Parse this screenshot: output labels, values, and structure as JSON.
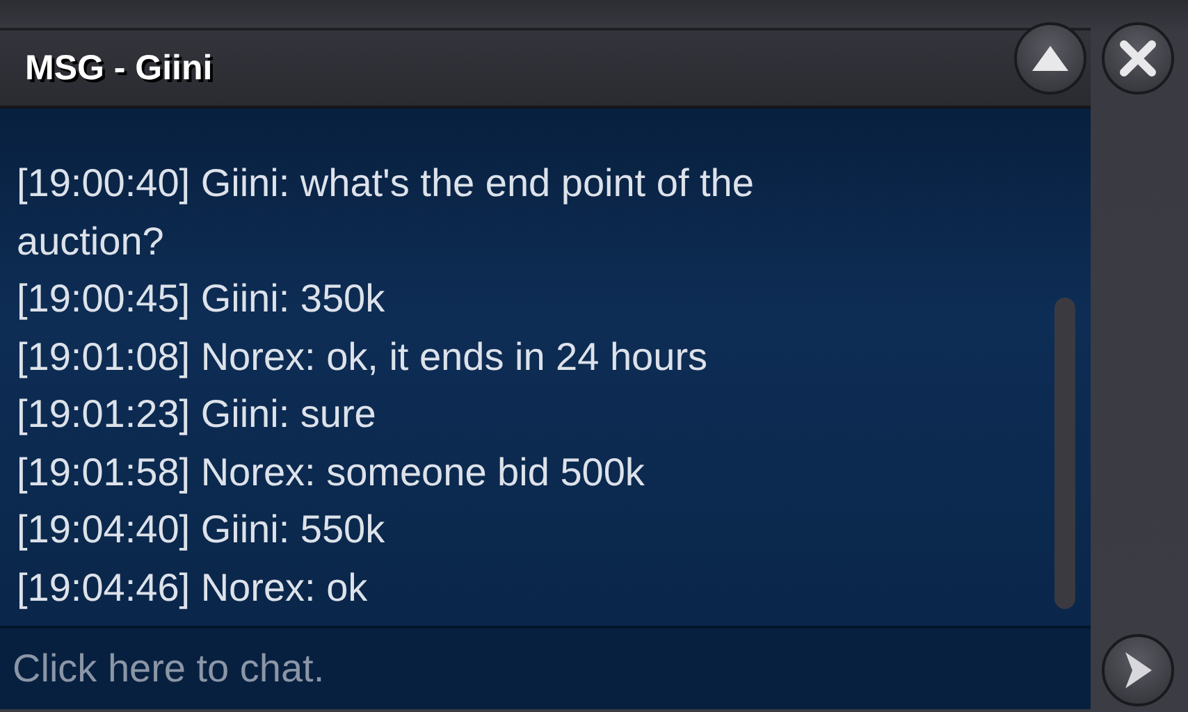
{
  "window": {
    "title": "MSG - Giini"
  },
  "messages": [
    {
      "time": "[19:00:40]",
      "sender": "Giini:",
      "text": "what's the end point of the auction?"
    },
    {
      "time": "[19:00:45]",
      "sender": "Giini:",
      "text": "350k"
    },
    {
      "time": "[19:01:08]",
      "sender": "Norex:",
      "text": "ok, it ends in 24 hours"
    },
    {
      "time": "[19:01:23]",
      "sender": "Giini:",
      "text": "sure"
    },
    {
      "time": "[19:01:58]",
      "sender": "Norex:",
      "text": "someone bid 500k"
    },
    {
      "time": "[19:04:40]",
      "sender": "Giini:",
      "text": "550k"
    },
    {
      "time": "[19:04:46]",
      "sender": "Norex:",
      "text": "ok"
    }
  ],
  "input": {
    "placeholder": "Click here to chat."
  }
}
